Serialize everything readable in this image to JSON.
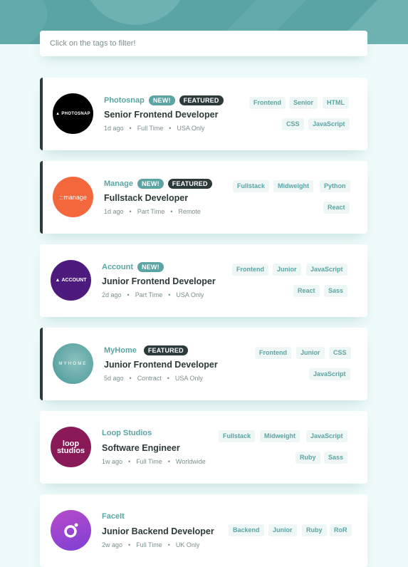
{
  "colors": {
    "primary": "#5ba4a4",
    "dark": "#2c3a3a",
    "background": "#effafa",
    "tag_background": "#eef6f6"
  },
  "filter": {
    "placeholder": "Click on the tags to filter!"
  },
  "jobs": [
    {
      "company": "Photosnap",
      "logo_text": "PHOTOSNAP",
      "logo_color": "#000000",
      "new_label": "NEW!",
      "featured_label": "FEATURED",
      "position": "Senior Frontend Developer",
      "posted": "1d ago",
      "contract": "Full Time",
      "location": "USA Only",
      "tags": [
        "Frontend",
        "Senior",
        "HTML",
        "CSS",
        "JavaScript"
      ]
    },
    {
      "company": "Manage",
      "logo_text": "manage",
      "logo_color": "#f3673d",
      "new_label": "NEW!",
      "featured_label": "FEATURED",
      "position": "Fullstack Developer",
      "posted": "1d ago",
      "contract": "Part Time",
      "location": "Remote",
      "tags": [
        "Fullstack",
        "Midweight",
        "Python",
        "React"
      ]
    },
    {
      "company": "Account",
      "logo_text": "ACCOUNT",
      "logo_color": "#4d1a7e",
      "new_label": "NEW!",
      "position": "Junior Frontend Developer",
      "posted": "2d ago",
      "contract": "Part Time",
      "location": "USA Only",
      "tags": [
        "Frontend",
        "Junior",
        "JavaScript",
        "React",
        "Sass"
      ]
    },
    {
      "company": "MyHome",
      "logo_text": "MYHOME",
      "logo_color": "#5ba4a4",
      "featured_label": "FEATURED",
      "position": "Junior Frontend Developer",
      "posted": "5d ago",
      "contract": "Contract",
      "location": "USA Only",
      "tags": [
        "Frontend",
        "Junior",
        "CSS",
        "JavaScript"
      ]
    },
    {
      "company": "Loop Studios",
      "logo_text": "loop studios",
      "logo_color": "#8a1a57",
      "position": "Software Engineer",
      "posted": "1w ago",
      "contract": "Full Time",
      "location": "Worldwide",
      "tags": [
        "Fullstack",
        "Midweight",
        "JavaScript",
        "Ruby",
        "Sass"
      ]
    },
    {
      "company": "FaceIt",
      "logo_color": "#7d3fd6",
      "position": "Junior Backend Developer",
      "posted": "2w ago",
      "contract": "Full Time",
      "location": "UK Only",
      "tags": [
        "Backend",
        "Junior",
        "Ruby",
        "RoR"
      ]
    }
  ]
}
